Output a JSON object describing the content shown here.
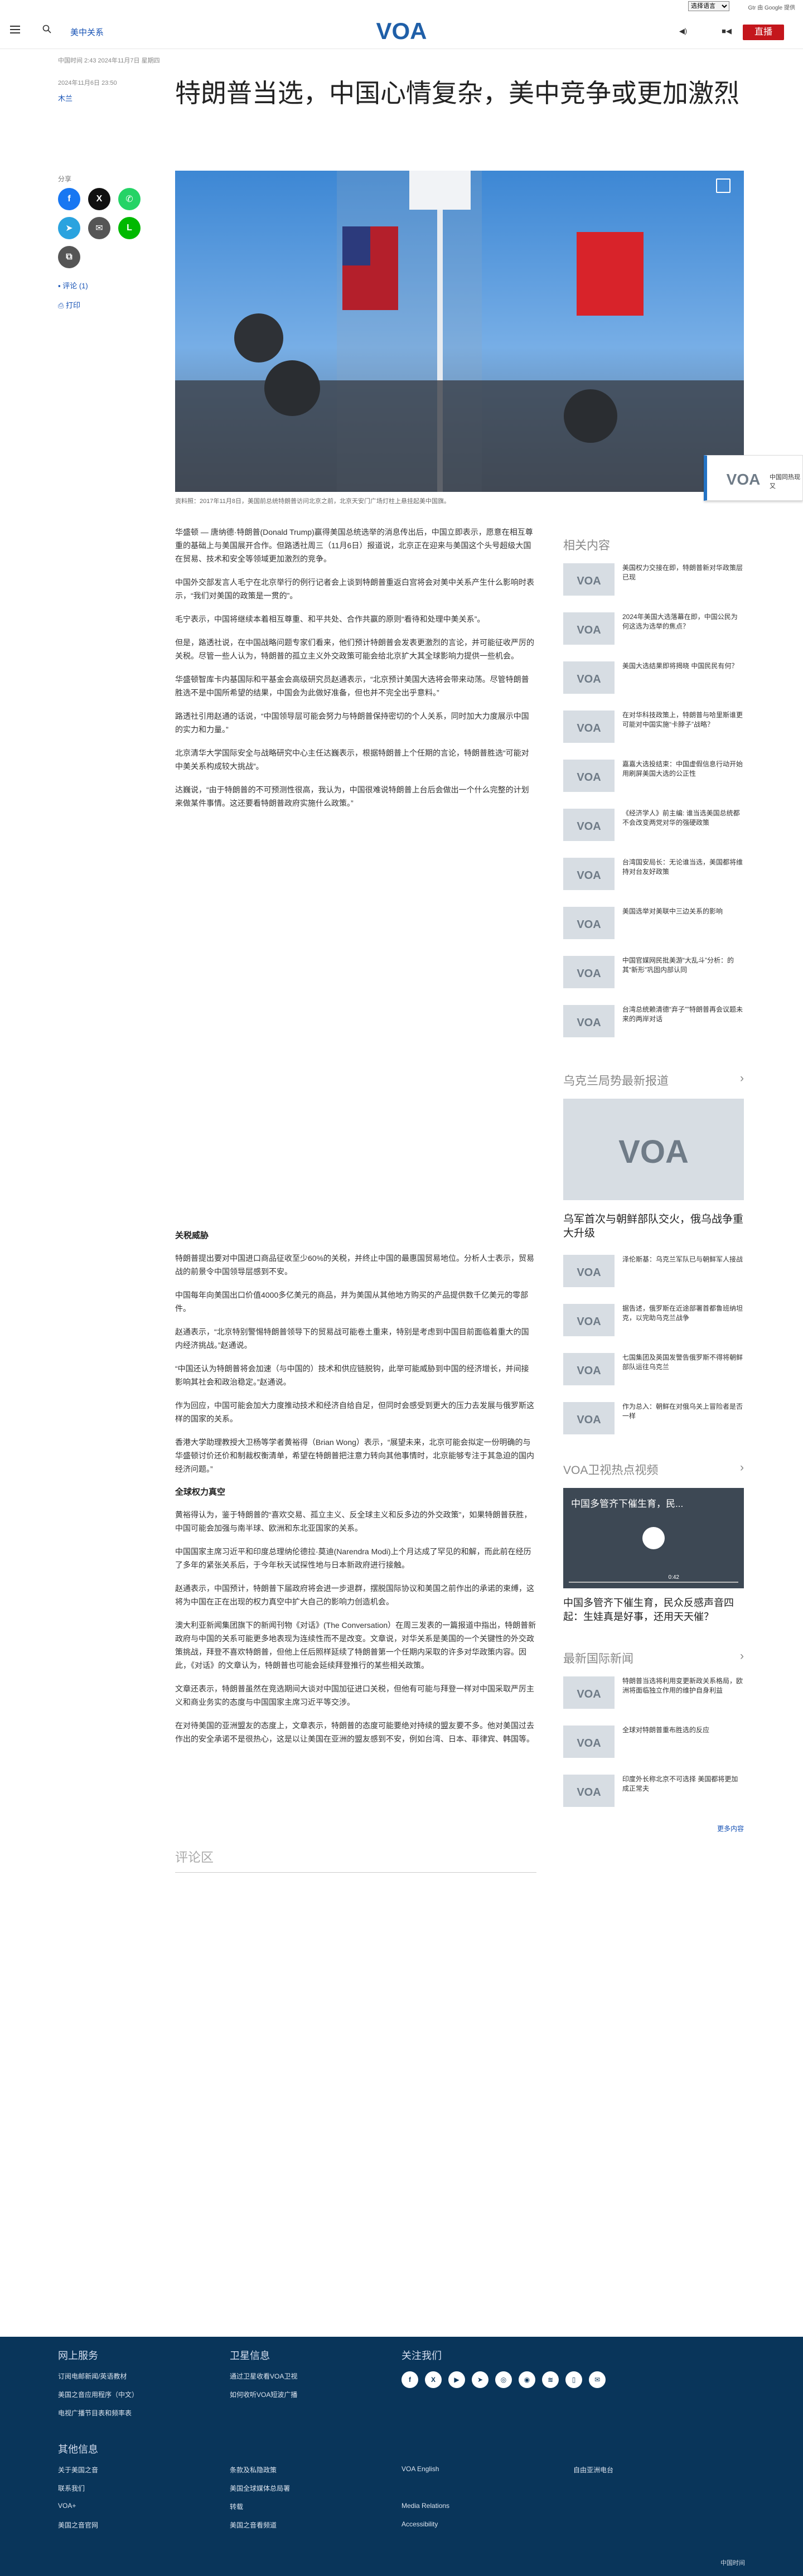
{
  "lang_select": "选择语言",
  "lang_powered": "Gtr 由 Google 提供",
  "header": {
    "section": "美中关系",
    "live": "直播"
  },
  "meta": {
    "published": "中国时间 2:43 2024年11月7日 星期四",
    "date": "2024年11月6日 23:50",
    "author": "木兰"
  },
  "title": "特朗普当选，中国心情复杂，美中竞争或更加激烈",
  "share": {
    "label": "分享",
    "comment": "评论 (1)",
    "print": "打印"
  },
  "caption": "资料照：2017年11月8日，美国前总统特朗普访问北京之前，北京天安门广场灯柱上悬挂起美中国旗。",
  "article": {
    "paras": [
      "华盛顿 — 唐纳德·特朗普(Donald Trump)赢得美国总统选举的消息传出后，中国立即表示，愿意在相互尊重的基础上与美国展开合作。但路透社周三（11月6日）报道说，北京正在迎来与美国这个头号超级大国在贸易、技术和安全等领域更加激烈的竞争。",
      "中国外交部发言人毛宁在北京举行的例行记者会上谈到特朗普重返白宫将会对美中关系产生什么影响时表示，“我们对美国的政策是一贯的”。",
      "毛宁表示，中国将继续本着相互尊重、和平共处、合作共赢的原则“看待和处理中美关系”。",
      "但是，路透社说，在中国战略问题专家们看来，他们预计特朗普会发表更激烈的言论，并可能征收严厉的关税。尽管一些人认为，特朗普的孤立主义外交政策可能会给北京扩大其全球影响力提供一些机会。",
      "华盛顿智库卡内基国际和平基金会高级研究员赵通表示，“北京预计美国大选将会带来动荡。尽管特朗普胜选不是中国所希望的结果，中国会为此做好准备，但也并不完全出乎意料。”",
      "路透社引用赵通的话说，“中国领导层可能会努力与特朗普保持密切的个人关系，同时加大力度展示中国的实力和力量。”",
      "北京清华大学国际安全与战略研究中心主任达巍表示，根据特朗普上个任期的言论，特朗普胜选“可能对中美关系构成较大挑战”。",
      "达巍说，“由于特朗普的不可预测性很高，我认为，中国很难说特朗普上台后会做出一个什么完整的计划来做某件事情。这还要看特朗普政府实施什么政策。”"
    ],
    "h1": "关税威胁",
    "paras2": [
      "特朗普提出要对中国进口商品征收至少60%的关税，并终止中国的最惠国贸易地位。分析人士表示，贸易战的前景令中国领导层感到不安。",
      "中国每年向美国出口价值4000多亿美元的商品，并为美国从其他地方购买的产品提供数千亿美元的零部件。",
      "赵通表示，“北京特别警惕特朗普领导下的贸易战可能卷土重来，特别是考虑到中国目前面临着重大的国内经济挑战。”赵通说。",
      "“中国还认为特朗普将会加速（与中国的）技术和供应链脱钩，此举可能威胁到中国的经济增长，并间接影响其社会和政治稳定。”赵通说。",
      "作为回应，中国可能会加大力度推动技术和经济自给自足，但同时会感受到更大的压力去发展与俄罗斯这样的国家的关系。",
      "香港大学助理教授大卫杨等学者黄裕得（Brian Wong）表示，“展望未来，北京可能会拟定一份明确的与华盛顿讨价还价和制裁权衡清单，希望在特朗普把注意力转向其他事情时，北京能够专注于其急迫的国内经济问题。”"
    ],
    "h2": "全球权力真空",
    "paras3": [
      "黄裕得认为，鉴于特朗普的“喜欢交易、孤立主义、反全球主义和反多边的外交政策”，如果特朗普获胜，中国可能会加强与南半球、欧洲和东北亚国家的关系。",
      "中国国家主席习近平和印度总理纳伦德拉·莫迪(Narendra Modi)上个月达成了罕见的和解，而此前在经历了多年的紧张关系后，于今年秋天试探性地与日本新政府进行接触。",
      "赵通表示，中国预计，特朗普下届政府将会进一步退群，摆脱国际协议和美国之前作出的承诺的束缚，这将为中国在正在出现的权力真空中扩大自己的影响力创造机会。",
      "澳大利亚新闻集团旗下的新闻刊物《对话》(The Conversation）在周三发表的一篇报道中指出，特朗普新政府与中国的关系可能更多地表现为连续性而不是改变。文章说，对华关系是美国的一个关键性的外交政策挑战，拜登不喜欢特朗普，但他上任后照样延续了特朗普第一个任期内采取的许多对华政策内容。因此，《对话》的文章认为，特朗普也可能会延续拜登推行的某些相关政策。",
      "文章还表示，特朗普虽然在竞选期间大谈对中国加征进口关税，但他有可能与拜登一样对中国采取严厉主义和商业务实的态度与中国国家主席习近平等交涉。",
      "在对待美国的亚洲盟友的态度上，文章表示，特朗普的态度可能要绝对持续的盟友要不多。他对美国过去作出的安全承诺不是很热心，这是以让美国在亚洲的盟友感到不安，例如台湾、日本、菲律宾、韩国等。"
    ]
  },
  "comments": "评论区",
  "sticky": "中国同热现又",
  "rail": {
    "related_title": "相关内容",
    "related": [
      "美国权力交接在即，特朗普新对华政策层已现",
      "2024年美国大选落幕在即，中国公民为何这选为选举的焦点？",
      "美国大选结果即将揭晓 中国民民有何？",
      "在对华科技政策上，特朗普与哈里斯谁更可能对中国实施“卡脖子”战略？",
      "嘉嘉大选投结束：中国虚假信息行动开始用刷屏美国大选的公正性",
      "《经济学人》前主编: 谁当选美国总统都不会改变两党对华的强硬政策",
      "台湾国安局长：无论谁当选，美国都将维持对台友好政策",
      "美国选举对美联中三边关系的影响",
      "中国官媒网民批美游“大乱斗”分析：的其“新形”巩固内部认同",
      "台湾总统赖清德“弃子””特朗普再会议题未来的两岸对话"
    ],
    "ukraine_title": "乌克兰局势最新报道",
    "ukraine_big": "乌军首次与朝鲜部队交火，俄乌战争重大升级",
    "ukraine": [
      "泽伦斯基：乌克兰军队已与朝鲜军人接战",
      "据告述，俄罗斯在近途部署首都鲁班纳坦克，以完助乌克兰战争",
      "七国集团及英国发警告俄罗斯不得将朝鲜部队运往乌克兰",
      "作为总入：朝鲜在对俄乌关上冒险者是否一样"
    ],
    "video_title": "VOA卫视热点视频",
    "video_overlay": "中国多管齐下催生育，民...",
    "video_time": "0:42",
    "video_caption": "中国多管齐下催生育，民众反感声音四起：生娃真是好事，还用天天催？",
    "intl_title": "最新国际新闻",
    "intl": [
      "特朗普当选将利用变更新政关系格局，欧洲将面临独立作用的维护自身利益",
      "全球对特朗普重布胜选的反应",
      "印度外长称北京不可选择 美国都将更加成正常夫"
    ],
    "more": "更多内容"
  },
  "footer": {
    "col1_title": "网上服务",
    "col1": [
      "订阅电邮新闻/英语教材",
      "美国之音应用程序（中文）",
      "电视广播节目表和频率表"
    ],
    "col2_title": "卫星信息",
    "col2": [
      "通过卫星收看VOA卫视",
      "如何收听VOA短波广播"
    ],
    "col3_title": "关注我们",
    "others_title": "其他信息",
    "others": [
      "关于美国之音",
      "条款及私隐政策",
      "VOA English",
      "自由亚洲电台",
      "联系我们",
      "美国全球媒体总局署",
      "",
      "",
      "VOA+",
      "转载",
      "Media Relations",
      "",
      "美国之音官网",
      "美国之音看频道",
      "Accessibility",
      ""
    ],
    "time": "中国时间"
  },
  "colors": {
    "accent": "#1652b5",
    "live": "#c4161c",
    "footer": "#09355a"
  }
}
